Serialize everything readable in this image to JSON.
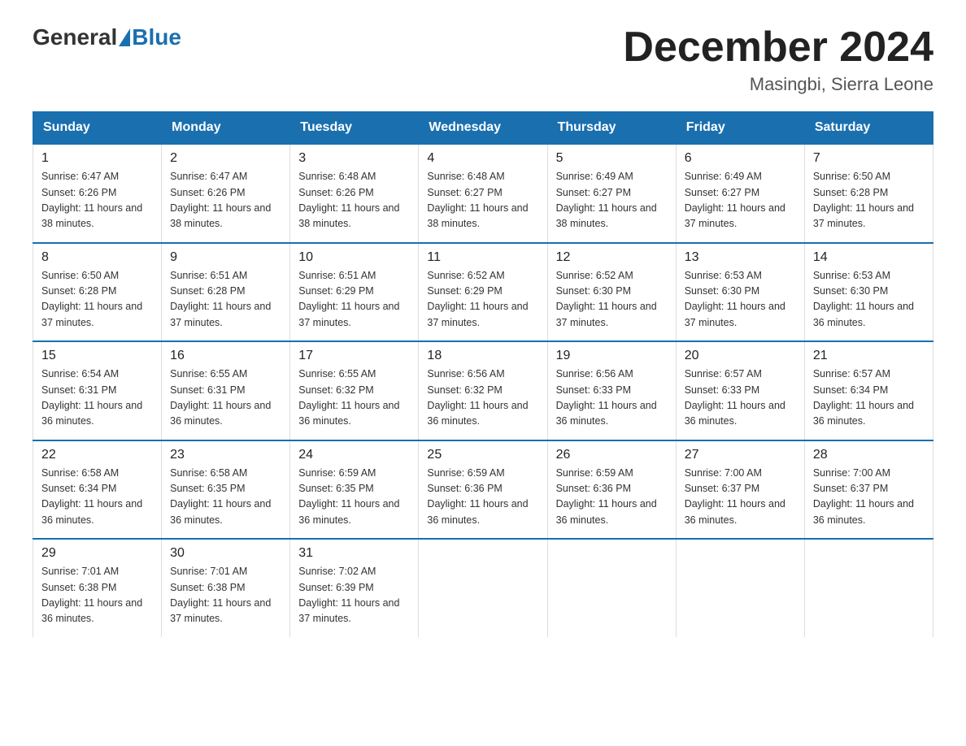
{
  "logo": {
    "general": "General",
    "blue": "Blue"
  },
  "title": "December 2024",
  "location": "Masingbi, Sierra Leone",
  "weekdays": [
    "Sunday",
    "Monday",
    "Tuesday",
    "Wednesday",
    "Thursday",
    "Friday",
    "Saturday"
  ],
  "weeks": [
    [
      {
        "day": "1",
        "sunrise": "6:47 AM",
        "sunset": "6:26 PM",
        "daylight": "11 hours and 38 minutes."
      },
      {
        "day": "2",
        "sunrise": "6:47 AM",
        "sunset": "6:26 PM",
        "daylight": "11 hours and 38 minutes."
      },
      {
        "day": "3",
        "sunrise": "6:48 AM",
        "sunset": "6:26 PM",
        "daylight": "11 hours and 38 minutes."
      },
      {
        "day": "4",
        "sunrise": "6:48 AM",
        "sunset": "6:27 PM",
        "daylight": "11 hours and 38 minutes."
      },
      {
        "day": "5",
        "sunrise": "6:49 AM",
        "sunset": "6:27 PM",
        "daylight": "11 hours and 38 minutes."
      },
      {
        "day": "6",
        "sunrise": "6:49 AM",
        "sunset": "6:27 PM",
        "daylight": "11 hours and 37 minutes."
      },
      {
        "day": "7",
        "sunrise": "6:50 AM",
        "sunset": "6:28 PM",
        "daylight": "11 hours and 37 minutes."
      }
    ],
    [
      {
        "day": "8",
        "sunrise": "6:50 AM",
        "sunset": "6:28 PM",
        "daylight": "11 hours and 37 minutes."
      },
      {
        "day": "9",
        "sunrise": "6:51 AM",
        "sunset": "6:28 PM",
        "daylight": "11 hours and 37 minutes."
      },
      {
        "day": "10",
        "sunrise": "6:51 AM",
        "sunset": "6:29 PM",
        "daylight": "11 hours and 37 minutes."
      },
      {
        "day": "11",
        "sunrise": "6:52 AM",
        "sunset": "6:29 PM",
        "daylight": "11 hours and 37 minutes."
      },
      {
        "day": "12",
        "sunrise": "6:52 AM",
        "sunset": "6:30 PM",
        "daylight": "11 hours and 37 minutes."
      },
      {
        "day": "13",
        "sunrise": "6:53 AM",
        "sunset": "6:30 PM",
        "daylight": "11 hours and 37 minutes."
      },
      {
        "day": "14",
        "sunrise": "6:53 AM",
        "sunset": "6:30 PM",
        "daylight": "11 hours and 36 minutes."
      }
    ],
    [
      {
        "day": "15",
        "sunrise": "6:54 AM",
        "sunset": "6:31 PM",
        "daylight": "11 hours and 36 minutes."
      },
      {
        "day": "16",
        "sunrise": "6:55 AM",
        "sunset": "6:31 PM",
        "daylight": "11 hours and 36 minutes."
      },
      {
        "day": "17",
        "sunrise": "6:55 AM",
        "sunset": "6:32 PM",
        "daylight": "11 hours and 36 minutes."
      },
      {
        "day": "18",
        "sunrise": "6:56 AM",
        "sunset": "6:32 PM",
        "daylight": "11 hours and 36 minutes."
      },
      {
        "day": "19",
        "sunrise": "6:56 AM",
        "sunset": "6:33 PM",
        "daylight": "11 hours and 36 minutes."
      },
      {
        "day": "20",
        "sunrise": "6:57 AM",
        "sunset": "6:33 PM",
        "daylight": "11 hours and 36 minutes."
      },
      {
        "day": "21",
        "sunrise": "6:57 AM",
        "sunset": "6:34 PM",
        "daylight": "11 hours and 36 minutes."
      }
    ],
    [
      {
        "day": "22",
        "sunrise": "6:58 AM",
        "sunset": "6:34 PM",
        "daylight": "11 hours and 36 minutes."
      },
      {
        "day": "23",
        "sunrise": "6:58 AM",
        "sunset": "6:35 PM",
        "daylight": "11 hours and 36 minutes."
      },
      {
        "day": "24",
        "sunrise": "6:59 AM",
        "sunset": "6:35 PM",
        "daylight": "11 hours and 36 minutes."
      },
      {
        "day": "25",
        "sunrise": "6:59 AM",
        "sunset": "6:36 PM",
        "daylight": "11 hours and 36 minutes."
      },
      {
        "day": "26",
        "sunrise": "6:59 AM",
        "sunset": "6:36 PM",
        "daylight": "11 hours and 36 minutes."
      },
      {
        "day": "27",
        "sunrise": "7:00 AM",
        "sunset": "6:37 PM",
        "daylight": "11 hours and 36 minutes."
      },
      {
        "day": "28",
        "sunrise": "7:00 AM",
        "sunset": "6:37 PM",
        "daylight": "11 hours and 36 minutes."
      }
    ],
    [
      {
        "day": "29",
        "sunrise": "7:01 AM",
        "sunset": "6:38 PM",
        "daylight": "11 hours and 36 minutes."
      },
      {
        "day": "30",
        "sunrise": "7:01 AM",
        "sunset": "6:38 PM",
        "daylight": "11 hours and 37 minutes."
      },
      {
        "day": "31",
        "sunrise": "7:02 AM",
        "sunset": "6:39 PM",
        "daylight": "11 hours and 37 minutes."
      },
      null,
      null,
      null,
      null
    ]
  ]
}
